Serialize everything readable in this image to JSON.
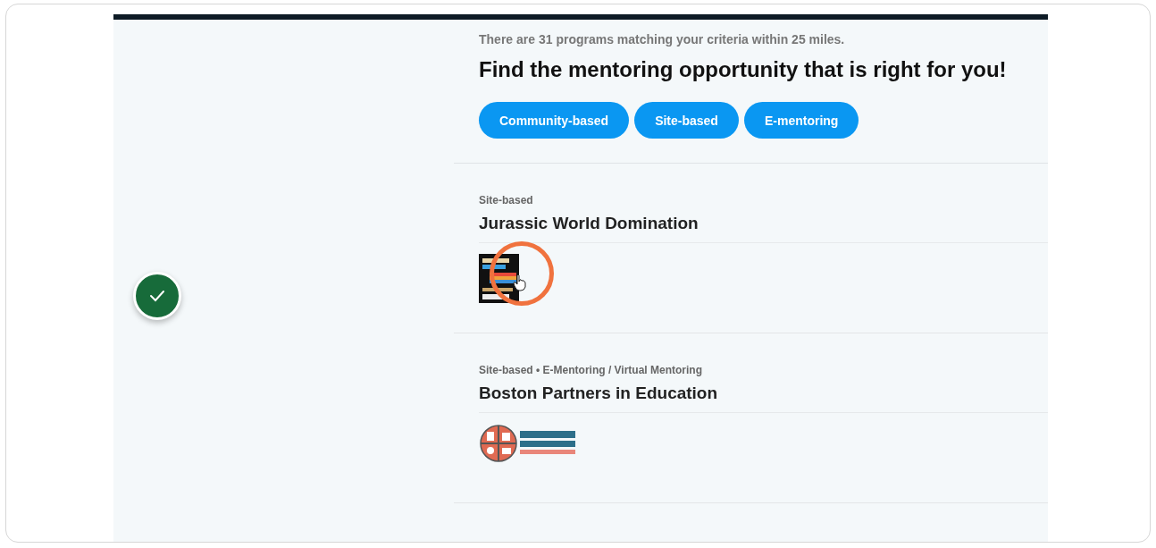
{
  "results_summary": "There are 31 programs matching your criteria within 25 miles.",
  "heading": "Find the mentoring opportunity that is right for you!",
  "filters": [
    {
      "label": "Community-based"
    },
    {
      "label": "Site-based"
    },
    {
      "label": "E-mentoring"
    }
  ],
  "programs": [
    {
      "categories": "Site-based",
      "name": "Jurassic World Domination",
      "kind": "poster",
      "highlighted": true
    },
    {
      "categories": "Site-based • E-Mentoring / Virtual Mentoring",
      "name": "Boston Partners in Education",
      "kind": "emblem",
      "highlighted": false
    }
  ]
}
